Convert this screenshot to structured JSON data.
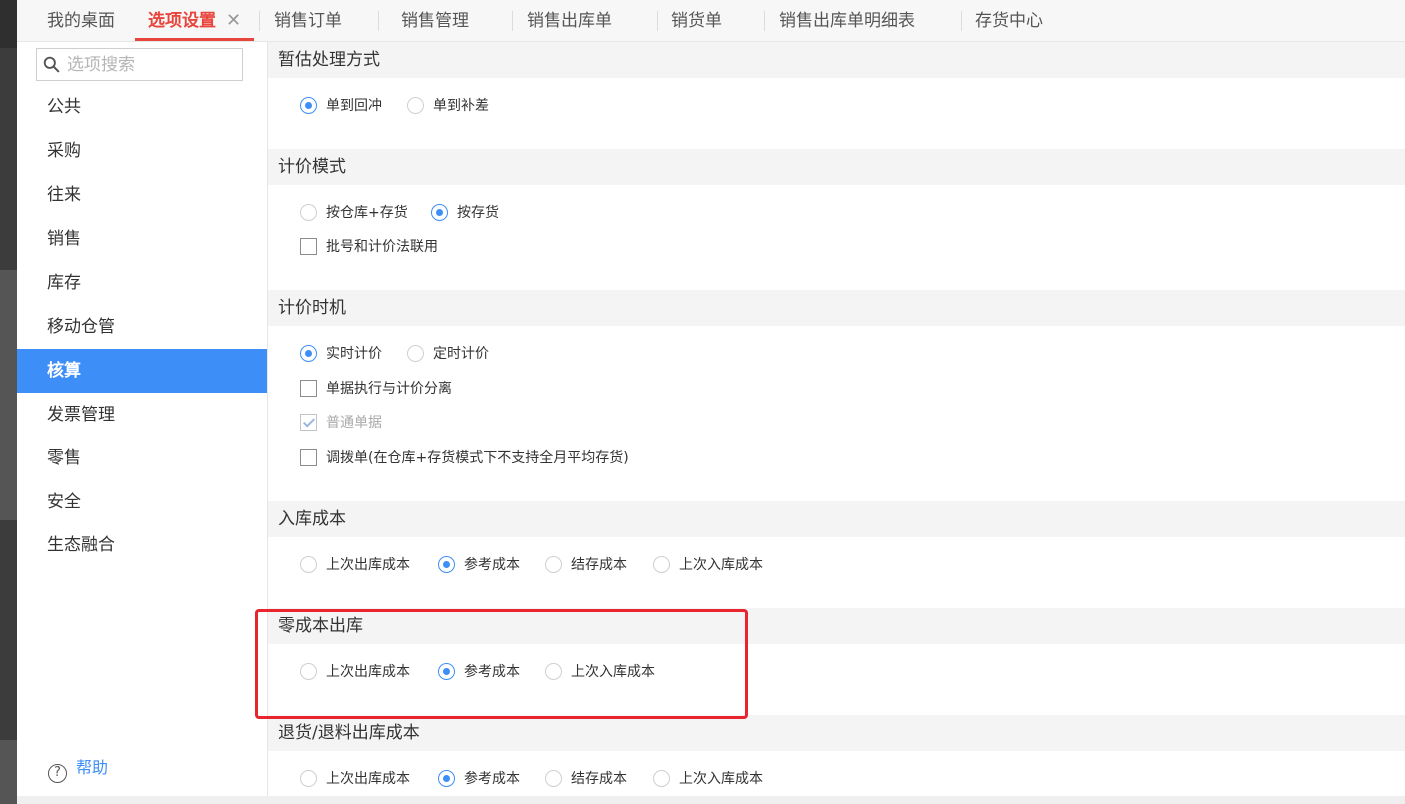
{
  "tabs": [
    {
      "label": "我的桌面"
    },
    {
      "label": "选项设置",
      "close": "✕"
    },
    {
      "label": "销售订单"
    },
    {
      "label": "销售管理"
    },
    {
      "label": "销售出库单"
    },
    {
      "label": "销货单"
    },
    {
      "label": "销售出库单明细表"
    },
    {
      "label": "存货中心"
    }
  ],
  "sidebar": {
    "search_placeholder": "选项搜索",
    "items": [
      {
        "label": "公共"
      },
      {
        "label": "采购"
      },
      {
        "label": "往来"
      },
      {
        "label": "销售"
      },
      {
        "label": "库存"
      },
      {
        "label": "移动仓管"
      },
      {
        "label": "核算"
      },
      {
        "label": "发票管理"
      },
      {
        "label": "零售"
      },
      {
        "label": "安全"
      },
      {
        "label": "生态融合"
      }
    ],
    "active_item": "核算",
    "help_label": "帮助",
    "help_icon": "?"
  },
  "sections": {
    "estimate": {
      "title": "暂估处理方式",
      "options": [
        {
          "label": "单到回冲",
          "checked": true
        },
        {
          "label": "单到补差",
          "checked": false
        }
      ]
    },
    "pricing_mode": {
      "title": "计价模式",
      "options": [
        {
          "label": "按仓库+存货",
          "checked": false
        },
        {
          "label": "按存货",
          "checked": true
        }
      ],
      "checkbox": {
        "label": "批号和计价法联用",
        "checked": false
      }
    },
    "pricing_timing": {
      "title": "计价时机",
      "options": [
        {
          "label": "实时计价",
          "checked": true
        },
        {
          "label": "定时计价",
          "checked": false
        }
      ],
      "checkboxes": [
        {
          "label": "单据执行与计价分离",
          "checked": false
        },
        {
          "label": "普通单据",
          "checked": true,
          "disabled": true
        },
        {
          "label": "调拨单(在仓库+存货模式下不支持全月平均存货)",
          "checked": false
        }
      ]
    },
    "inbound_cost": {
      "title": "入库成本",
      "options": [
        {
          "label": "上次出库成本",
          "checked": false
        },
        {
          "label": "参考成本",
          "checked": true
        },
        {
          "label": "结存成本",
          "checked": false
        },
        {
          "label": "上次入库成本",
          "checked": false
        }
      ]
    },
    "zero_cost": {
      "title": "零成本出库",
      "options": [
        {
          "label": "上次出库成本",
          "checked": false
        },
        {
          "label": "参考成本",
          "checked": true
        },
        {
          "label": "上次入库成本",
          "checked": false
        }
      ]
    },
    "return_cost": {
      "title": "退货/退料出库成本",
      "options": [
        {
          "label": "上次出库成本",
          "checked": false
        },
        {
          "label": "参考成本",
          "checked": true
        },
        {
          "label": "结存成本",
          "checked": false
        },
        {
          "label": "上次入库成本",
          "checked": false
        }
      ]
    }
  },
  "colors": {
    "accent_blue": "#3e8ef7",
    "active_tab_red": "#e8453c",
    "highlight_red": "#e8242e"
  }
}
